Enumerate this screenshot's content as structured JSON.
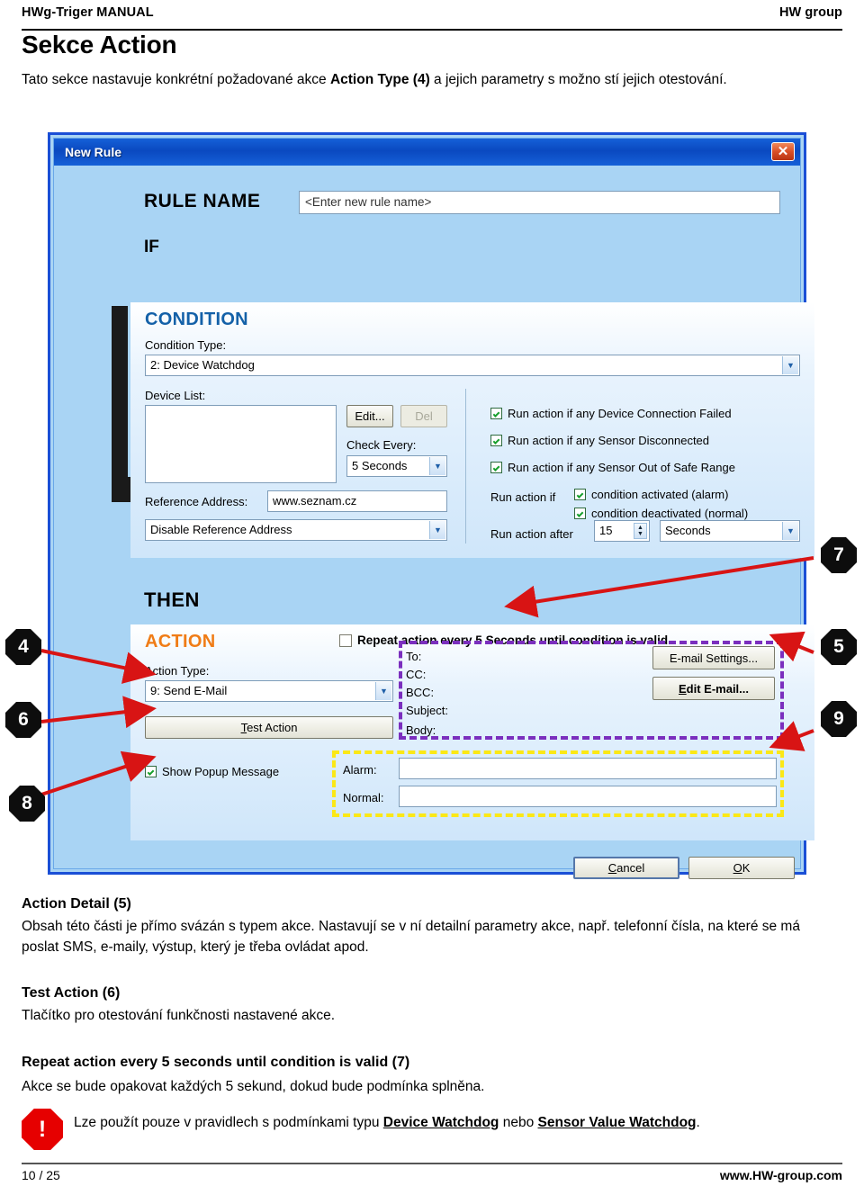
{
  "page": {
    "header_left": "HWg-Triger MANUAL",
    "header_right": "HW group",
    "title": "Sekce Action",
    "intro_part1": "Tato sekce nastavuje konkrétní požadované akce ",
    "intro_bold": "Action Type (4)",
    "intro_part2": " a jejich parametry s možno stí jejich otestování.",
    "footer_left": "10 / 25",
    "footer_right": "www.HW-group.com"
  },
  "dialog": {
    "title": "New Rule",
    "close_icon": "✕",
    "rule_name_label": "RULE NAME",
    "rule_name_value": "<Enter new rule name>",
    "if_label": "IF",
    "then_label": "THEN",
    "condition": {
      "panel_title": "CONDITION",
      "condition_type_label": "Condition Type:",
      "condition_type_value": "2: Device Watchdog",
      "device_list_label": "Device List:",
      "device_list_value": "",
      "edit_button": "Edit...",
      "del_button": "Del",
      "check_every_label": "Check Every:",
      "check_every_value": "5 Seconds",
      "reference_address_label": "Reference Address:",
      "reference_address_value": "www.seznam.cz",
      "disable_reference_value": "Disable Reference Address",
      "checkboxes": [
        {
          "label": "Run action if any Device Connection Failed",
          "checked": true
        },
        {
          "label": "Run action if any Sensor Disconnected",
          "checked": true
        },
        {
          "label": "Run action if any Sensor Out of Safe Range",
          "checked": true
        }
      ],
      "run_action_if_label": "Run action if",
      "run_action_if_options": [
        {
          "label": "condition activated (alarm)",
          "checked": true
        },
        {
          "label": "condition deactivated (normal)",
          "checked": true
        }
      ],
      "run_action_after_label": "Run action after",
      "run_action_after_value": "15",
      "run_action_after_unit": "Seconds"
    },
    "action": {
      "panel_title": "ACTION",
      "repeat_label": "Repeat action every 5 Seconds until condition is valid",
      "repeat_checked": false,
      "action_type_label": "Action Type:",
      "action_type_value": "9: Send E-Mail",
      "test_action_button": "Test Action",
      "detail_labels": [
        "To:",
        "CC:",
        "BCC:",
        "Subject:",
        "Body:"
      ],
      "email_settings_button": "E-mail Settings...",
      "edit_email_button": "Edit E-mail...",
      "show_popup_label": "Show Popup Message",
      "show_popup_checked": true,
      "alarm_label": "Alarm:",
      "alarm_value": "",
      "normal_label": "Normal:",
      "normal_value": ""
    },
    "cancel_button": "Cancel",
    "ok_button": "OK"
  },
  "callouts": [
    {
      "id": "4",
      "number": "4"
    },
    {
      "id": "6",
      "number": "6"
    },
    {
      "id": "8",
      "number": "8"
    },
    {
      "id": "7",
      "number": "7"
    },
    {
      "id": "5",
      "number": "5"
    },
    {
      "id": "9",
      "number": "9"
    }
  ],
  "sections": [
    {
      "heading": "Action Detail (5)",
      "body": "Obsah této části je přímo svázán s typem akce. Nastavují se v ní detailní parametry akce, např. telefonní čísla, na které se má poslat SMS, e-maily, výstup, který je třeba ovládat apod."
    },
    {
      "heading": "Test Action (6)",
      "body": "Tlačítko pro otestování funkčnosti nastavené akce."
    },
    {
      "heading": "Repeat action every 5 seconds until condition is valid (7)",
      "body": "Akce se bude opakovat každých 5 sekund, dokud bude podmínka splněna."
    }
  ],
  "note": {
    "icon": "!",
    "text_part1": "Lze použít pouze v pravidlech s podmínkami typu ",
    "bold1": "Device Watchdog",
    "text_part2": " nebo ",
    "bold2": "Sensor Value Watchdog",
    "text_part3": "."
  },
  "colors": {
    "dialog_bg": "#a9d4f4",
    "titlebar": "#0a49c0",
    "condition_accent": "#1461a8",
    "action_accent": "#f07c16",
    "highlight_purple": "#7b2fbe",
    "highlight_yellow": "#fbe816",
    "arrow_red": "#d81414",
    "note_red": "#e60000"
  }
}
